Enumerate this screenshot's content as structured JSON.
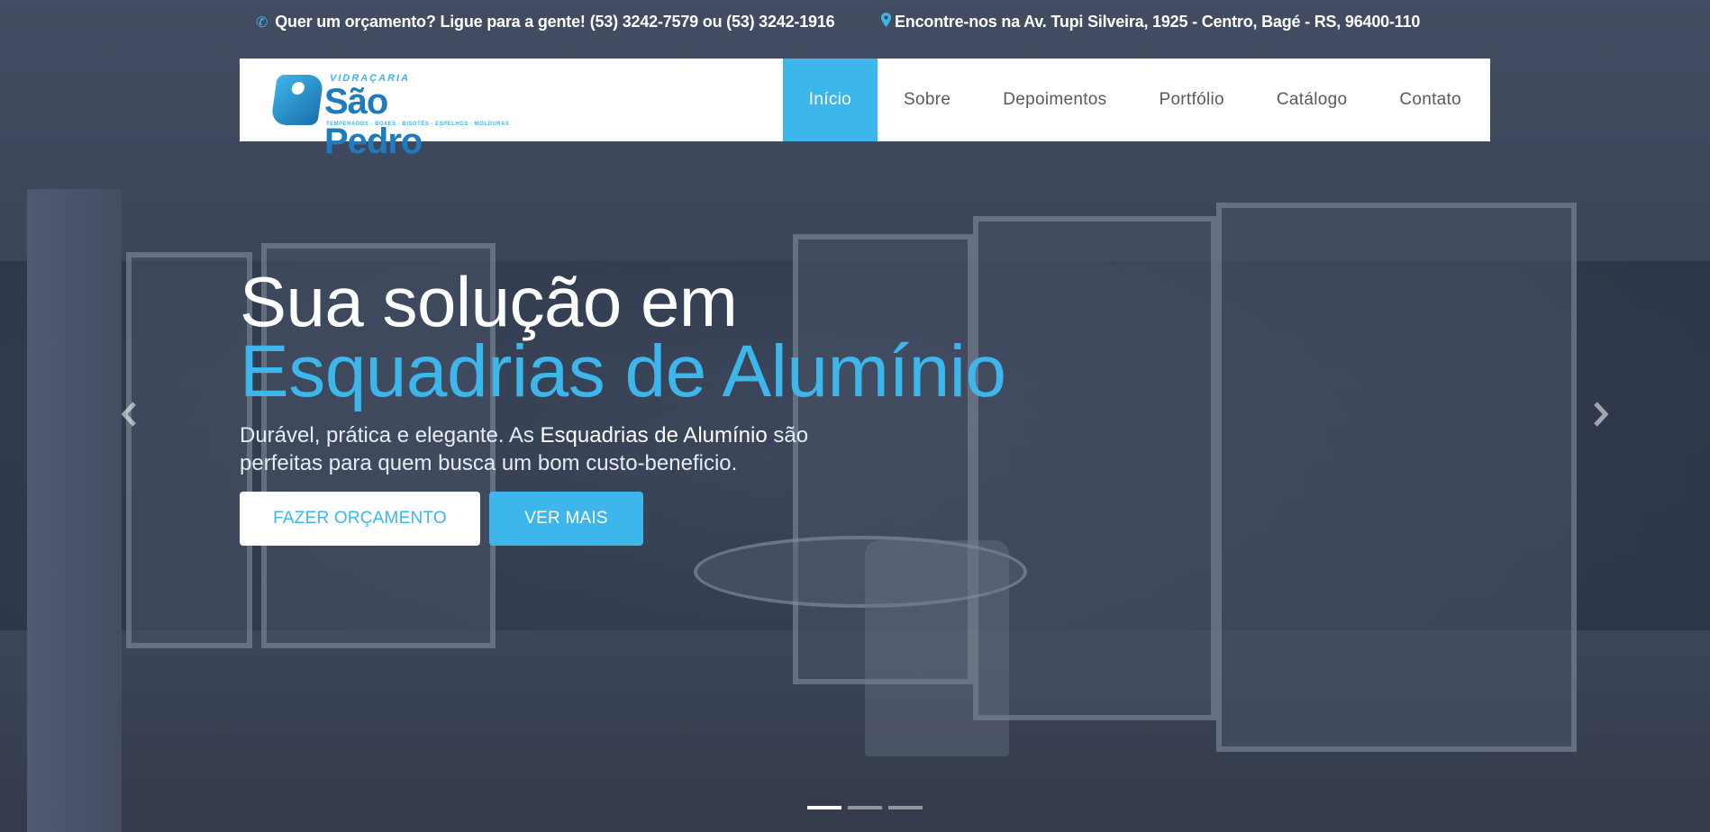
{
  "topbar": {
    "phone_lead": "Quer um orçamento? Ligue para a gente!",
    "phones": "(53) 3242-7579 ou (53) 3242-1916",
    "address": "Encontre-nos na Av. Tupi Silveira, 1925 - Centro, Bagé - RS, 96400-110",
    "phone_icon": "phone-icon",
    "address_icon": "map-pin-icon"
  },
  "logo": {
    "top_text": "VIDRAÇARIA",
    "name": "São Pedro",
    "tagline": "TEMPERADOS · BOXES · BISOTÊS · ESPELHOS · MOLDURAS"
  },
  "nav": {
    "items": [
      "Início",
      "Sobre",
      "Depoimentos",
      "Portfólio",
      "Catálogo",
      "Contato"
    ],
    "active": "Início"
  },
  "hero": {
    "title_line1": "Sua solução em",
    "title_line2": "Esquadrias de Alumínio",
    "desc_part1": "Durável, prática e elegante. As ",
    "desc_highlight": "Esquadrias de Alumínio",
    "desc_part2": " são perfeitas para quem busca um bom custo-beneficio.",
    "btn_quote": "FAZER ORÇAMENTO",
    "btn_more": "VER MAIS"
  },
  "carousel": {
    "slide_count": 3,
    "active_slide": 1,
    "prev_icon": "chevron-left-icon",
    "next_icon": "chevron-right-icon"
  },
  "colors": {
    "accent": "#3db6ec",
    "logo_blue": "#1f7bbf",
    "white": "#ffffff"
  }
}
